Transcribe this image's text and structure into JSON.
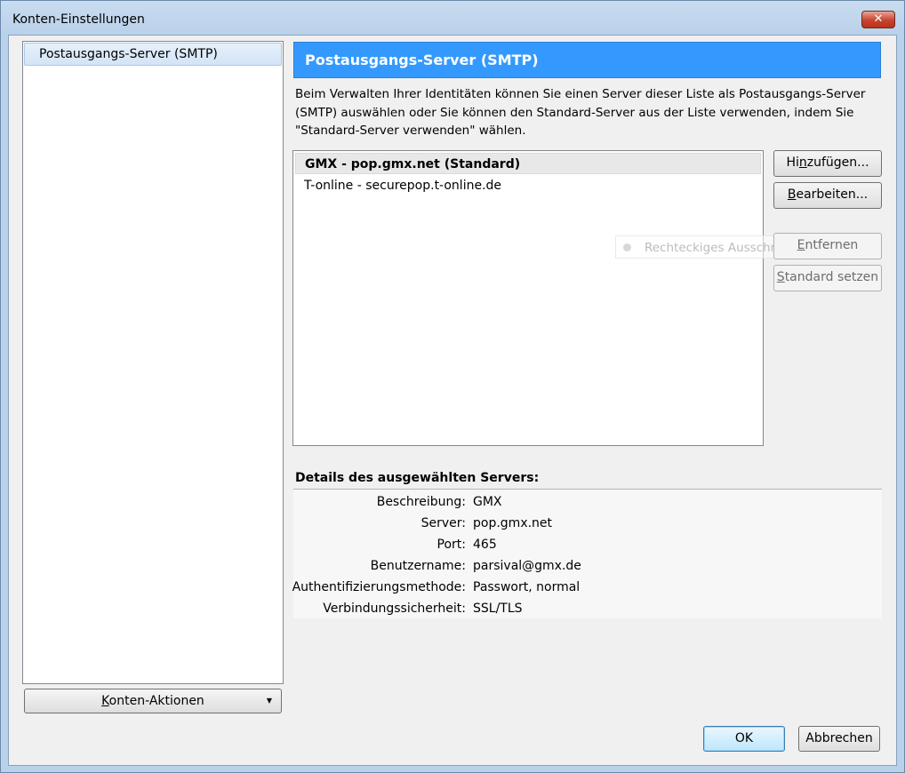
{
  "window": {
    "title": "Konten-Einstellungen",
    "close_glyph": "✕"
  },
  "sidebar": {
    "items": [
      {
        "label": "Postausgangs-Server (SMTP)",
        "selected": true
      }
    ],
    "account_actions": {
      "label_prefix": "",
      "label_mnemonic": "K",
      "label_rest": "onten-Aktionen",
      "dropdown_glyph": "▼"
    }
  },
  "main": {
    "header": "Postausgangs-Server (SMTP)",
    "description": "Beim Verwalten Ihrer Identitäten können Sie einen Server dieser Liste als Postausgangs-Server (SMTP) auswählen oder Sie können den Standard-Server aus der Liste verwenden, indem Sie \"Standard-Server verwenden\" wählen.",
    "servers": [
      {
        "label": "GMX - pop.gmx.net (Standard)",
        "selected": true
      },
      {
        "label": "T-online - securepop.t-online.de",
        "selected": false
      }
    ],
    "buttons": {
      "add": {
        "pre": "Hi",
        "mnemonic": "n",
        "post": "zufügen...",
        "enabled": true
      },
      "edit": {
        "pre": "",
        "mnemonic": "B",
        "post": "earbeiten...",
        "enabled": true
      },
      "remove": {
        "pre": "",
        "mnemonic": "E",
        "post": "ntfernen",
        "enabled": false
      },
      "set_default": {
        "pre": "",
        "mnemonic": "S",
        "post": "tandard setzen",
        "enabled": false
      }
    },
    "overlay_hint": "Rechteckiges Ausschneiden",
    "details": {
      "title": "Details des ausgewählten Servers:",
      "rows": [
        {
          "label": "Beschreibung:",
          "value": "GMX"
        },
        {
          "label": "Server:",
          "value": "pop.gmx.net"
        },
        {
          "label": "Port:",
          "value": "465"
        },
        {
          "label": "Benutzername:",
          "value": "parsival@gmx.de"
        },
        {
          "label": "Authentifizierungsmethode:",
          "value": "Passwort, normal"
        },
        {
          "label": "Verbindungssicherheit:",
          "value": "SSL/TLS"
        }
      ]
    }
  },
  "footer": {
    "ok": "OK",
    "cancel": "Abbrechen"
  },
  "colors": {
    "header_accent": "#3399ff",
    "window_frame": "#b9d1ea",
    "close_button": "#c7432e"
  }
}
